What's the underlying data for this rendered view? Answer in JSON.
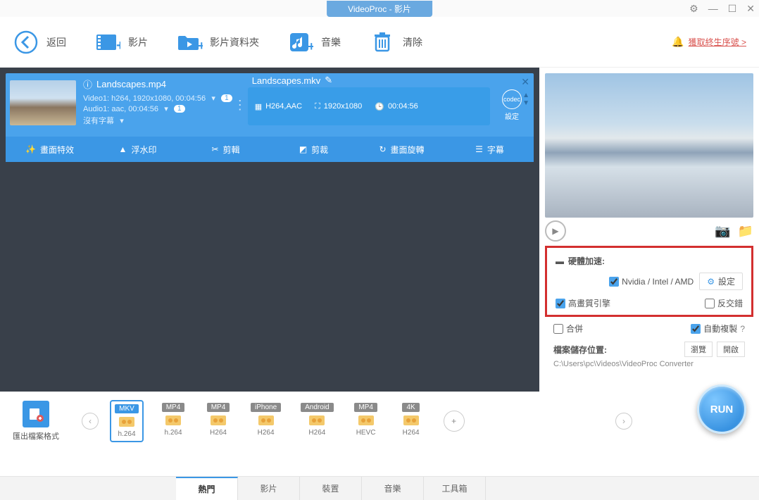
{
  "titlebar": {
    "title": "VideoProc - 影片"
  },
  "toolbar": {
    "back": "返回",
    "video": "影片",
    "folder": "影片資料夾",
    "music": "音樂",
    "clear": "清除",
    "promo": "獲取終生序號 >"
  },
  "card": {
    "src_name": "Landscapes.mp4",
    "video_line": "Video1: h264, 1920x1080, 00:04:56",
    "audio_line": "Audio1: aac, 00:04:56",
    "sub_line": "沒有字幕",
    "badge1": "1",
    "badge2": "1",
    "out_name": "Landscapes.mkv",
    "out_codec": "H264,AAC",
    "out_res": "1920x1080",
    "out_dur": "00:04:56",
    "codec_label": "設定",
    "codec_inner": "codec",
    "tabs": [
      "畫面特效",
      "浮水印",
      "剪輯",
      "剪裁",
      "畫面旋轉",
      "字幕"
    ]
  },
  "hw": {
    "title": "硬體加速:",
    "gpu": "Nvidia / Intel / AMD",
    "settings": "設定",
    "hq": "高畫質引擎",
    "deint": "反交錯"
  },
  "opts": {
    "merge": "合併",
    "autocopy": "自動複製",
    "q": "?"
  },
  "loc": {
    "title": "檔案儲存位置:",
    "browse": "瀏覽",
    "open": "開啟",
    "path": "C:\\Users\\pc\\Videos\\VideoProc Converter"
  },
  "output_format_label": "匯出檔案格式",
  "formats": [
    {
      "badge": "MKV",
      "color": "#3b97e5",
      "codec": "h.264",
      "selected": true
    },
    {
      "badge": "MP4",
      "color": "#8a8a8a",
      "codec": "h.264"
    },
    {
      "badge": "MP4",
      "color": "#8a8a8a",
      "codec": "H264"
    },
    {
      "badge": "iPhone",
      "color": "#8a8a8a",
      "codec": "H264"
    },
    {
      "badge": "Android",
      "color": "#8a8a8a",
      "codec": "H264"
    },
    {
      "badge": "MP4",
      "color": "#8a8a8a",
      "codec": "HEVC"
    },
    {
      "badge": "4K",
      "color": "#8a8a8a",
      "codec": "H264"
    }
  ],
  "bottom_tabs": {
    "hot": "熱門",
    "video": "影片",
    "device": "裝置",
    "music": "音樂",
    "toolbox": "工具箱"
  },
  "run": "RUN"
}
